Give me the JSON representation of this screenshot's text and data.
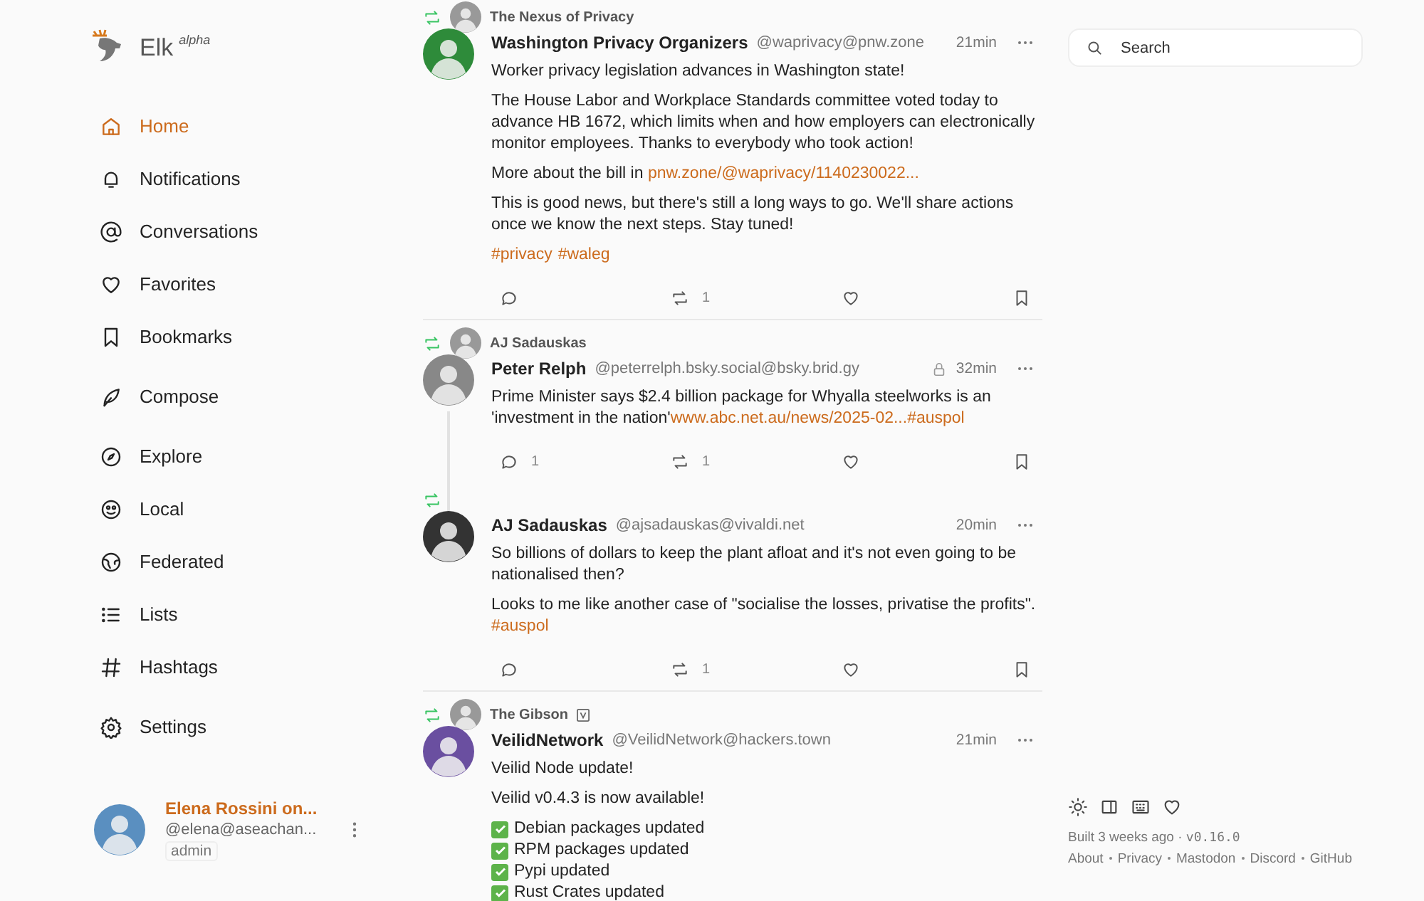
{
  "app": {
    "name": "Elk",
    "tag": "alpha"
  },
  "nav": [
    {
      "items": [
        {
          "label": "Home",
          "selected": true
        },
        {
          "label": "Notifications",
          "selected": false
        },
        {
          "label": "Conversations",
          "selected": false
        },
        {
          "label": "Favorites",
          "selected": false
        },
        {
          "label": "Bookmarks",
          "selected": false
        }
      ]
    },
    {
      "items": [
        {
          "label": "Compose",
          "selected": false
        }
      ]
    },
    {
      "items": [
        {
          "label": "Explore",
          "selected": false
        },
        {
          "label": "Local",
          "selected": false
        },
        {
          "label": "Federated",
          "selected": false
        },
        {
          "label": "Lists",
          "selected": false
        },
        {
          "label": "Hashtags",
          "selected": false
        }
      ]
    },
    {
      "items": [
        {
          "label": "Settings",
          "selected": false
        }
      ]
    }
  ],
  "account": {
    "name": "Elena Rossini on...",
    "handle": "@elena@aseachan...",
    "role": "admin"
  },
  "posts": [
    {
      "boosted": true,
      "boosted_by": "The Nexus of Privacy",
      "bot": false,
      "author": "Washington Privacy Organizers",
      "handle": "@waprivacy@pnw.zone",
      "locked": false,
      "time": "21min",
      "thread": false,
      "paragraphs": [
        {
          "kind": "text",
          "segments": [
            {
              "kind": "plain",
              "text": "Worker privacy legislation advances in Washington state!"
            }
          ]
        },
        {
          "kind": "text",
          "segments": [
            {
              "kind": "plain",
              "text": "The House Labor and Workplace Standards committee voted today to advance HB 1672, which limits when and how employers can electronically monitor employees. Thanks to everybody who took action!"
            }
          ]
        },
        {
          "kind": "text",
          "segments": [
            {
              "kind": "plain",
              "text": "More about the bill in "
            },
            {
              "kind": "link",
              "text": "pnw.zone/@waprivacy/1140230022..."
            }
          ]
        },
        {
          "kind": "text",
          "segments": [
            {
              "kind": "plain",
              "text": "This is good news, but there's still a long ways to go. We'll share actions once we know the next steps. Stay tuned!"
            }
          ]
        },
        {
          "kind": "tags",
          "tags": [
            "#privacy",
            "#waleg"
          ]
        }
      ],
      "actions": {
        "boosts": "1"
      }
    },
    {
      "boosted": true,
      "boosted_by": "AJ Sadauskas",
      "bot": false,
      "author": "Peter Relph",
      "handle": "@peterrelph.bsky.social@bsky.brid.gy",
      "locked": true,
      "time": "32min",
      "thread": true,
      "paragraphs": [
        {
          "kind": "text",
          "segments": [
            {
              "kind": "plain",
              "text": "Prime Minister says $2.4 billion package for Whyalla steelworks is an 'investment in the nation'"
            },
            {
              "kind": "link",
              "text": "www.abc.net.au/news/2025-02..."
            },
            {
              "kind": "link",
              "text": "#auspol"
            }
          ]
        }
      ],
      "actions": {
        "replies": "1",
        "boosts": "1"
      }
    },
    {
      "boosted": true,
      "bot": false,
      "author": "AJ Sadauskas",
      "handle": "@ajsadauskas@vivaldi.net",
      "locked": false,
      "time": "20min",
      "thread": false,
      "paragraphs": [
        {
          "kind": "text",
          "segments": [
            {
              "kind": "plain",
              "text": "So billions of dollars to keep the plant afloat and it's not even going to be nationalised then?"
            }
          ]
        },
        {
          "kind": "text",
          "segments": [
            {
              "kind": "plain",
              "text": "Looks to me like another case of \"socialise the losses, privatise the profits\". "
            },
            {
              "kind": "link",
              "text": "#auspol"
            }
          ]
        }
      ],
      "actions": {
        "boosts": "1"
      }
    },
    {
      "boosted": true,
      "boosted_by": "The Gibson",
      "bot": true,
      "author": "VeilidNetwork",
      "handle": "@VeilidNetwork@hackers.town",
      "locked": false,
      "time": "21min",
      "thread": false,
      "paragraphs": [
        {
          "kind": "text",
          "segments": [
            {
              "kind": "plain",
              "text": "Veilid Node update!"
            }
          ]
        },
        {
          "kind": "text",
          "segments": [
            {
              "kind": "plain",
              "text": "Veilid v0.4.3 is now available!"
            }
          ]
        },
        {
          "kind": "check",
          "text": "Debian packages updated"
        },
        {
          "kind": "check",
          "text": "RPM packages updated"
        },
        {
          "kind": "check",
          "text": "Pypi updated"
        },
        {
          "kind": "check",
          "text": "Rust Crates updated"
        }
      ]
    }
  ],
  "search": {
    "placeholder": "Search"
  },
  "footer": {
    "built": "Built 3 weeks ago ·",
    "version": "v0.16.0",
    "links": [
      "About",
      "Privacy",
      "Mastodon",
      "Discord",
      "GitHub"
    ]
  }
}
